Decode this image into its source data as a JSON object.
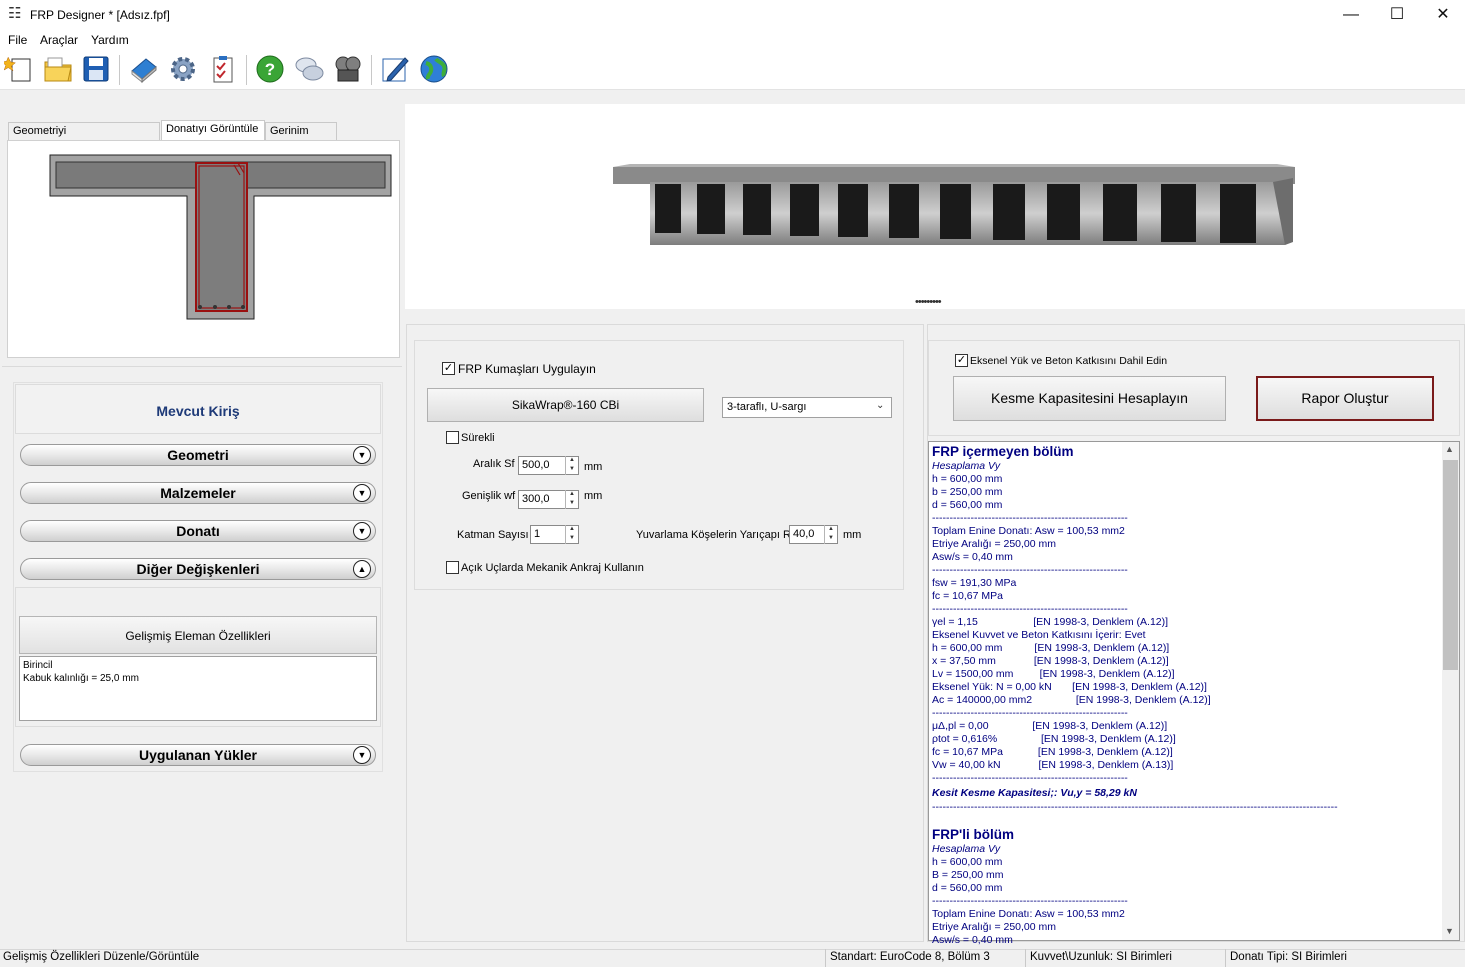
{
  "window": {
    "title": "FRP Designer * [Adsız.fpf]",
    "app_icon": "grid-icon",
    "controls": {
      "minimize": "—",
      "maximize": "☐",
      "close": "✕"
    }
  },
  "menu": [
    "File",
    "Araçlar",
    "Yardım"
  ],
  "toolbar": {
    "buttons": [
      "new-project-icon",
      "open-folder-icon",
      "save-icon",
      "book-icon",
      "settings-gear-icon",
      "checklist-icon",
      "help-icon",
      "chat-icon",
      "film-reel-icon",
      "pen-edit-icon",
      "globe-icon"
    ]
  },
  "left_tabs": [
    {
      "label": "Geometriyi Düzenle/Görüntüle",
      "active": false
    },
    {
      "label": "Donatıyı Görüntüle",
      "active": true
    },
    {
      "label": "Gerinim Profili",
      "active": false
    }
  ],
  "section": {
    "title": "Mevcut Kiriş",
    "items": [
      {
        "label": "Geometri",
        "state": "collapsed"
      },
      {
        "label": "Malzemeler",
        "state": "collapsed"
      },
      {
        "label": "Donatı",
        "state": "collapsed"
      },
      {
        "label": "Diğer Değişkenleri",
        "state": "expanded"
      }
    ],
    "advanced_button": "Gelişmiş Eleman Özellikleri",
    "advanced_text": [
      "Birincil",
      "Kabuk kalınlığı = 25,0 mm"
    ],
    "loads": {
      "label": "Uygulanan Yükler",
      "state": "collapsed"
    }
  },
  "frp": {
    "apply_label": "FRP Kumaşları Uygulayın",
    "apply_checked": true,
    "product_button": "SikaWrap®-160 CBi",
    "wrap_type": "3-taraflı, U-sargı",
    "continuous_label": "Sürekli",
    "continuous_checked": false,
    "spacing_label": "Aralık Sf",
    "spacing_value": "500,0",
    "width_label": "Genişlik wf",
    "width_value": "300,0",
    "unit_mm": "mm",
    "layers_label": "Katman Sayısı",
    "layers_value": "1",
    "radius_label": "Yuvarlama Köşelerin Yarıçapı R",
    "radius_value": "40,0",
    "anchor_label": "Açık Uçlarda Mekanik Ankraj Kullanın",
    "anchor_checked": false
  },
  "analysis": {
    "axial_label": "Eksenel Yük ve Beton Katkısını Dahil Edin",
    "axial_checked": true,
    "calc_button": "Kesme Kapasitesini Hesaplayın",
    "report_button": "Rapor Oluştur"
  },
  "results": [
    {
      "t": "FRP içermeyen bölüm",
      "s": "h"
    },
    {
      "t": "Hesaplama Vy",
      "s": "i"
    },
    {
      "t": "h = 600,00 mm"
    },
    {
      "t": "b = 250,00 mm"
    },
    {
      "t": "d = 560,00 mm"
    },
    {
      "t": "--------------------------------------------------------"
    },
    {
      "t": "Toplam Enine Donatı: Asw = 100,53 mm2"
    },
    {
      "t": "Etriye Aralığı = 250,00 mm"
    },
    {
      "t": "Asw/s = 0,40 mm"
    },
    {
      "t": "--------------------------------------------------------"
    },
    {
      "t": "fsw = 191,30 MPa"
    },
    {
      "t": "fc = 10,67 MPa"
    },
    {
      "t": "--------------------------------------------------------"
    },
    {
      "t": "γel = 1,15                   [EN 1998-3, Denklem (A.12)]"
    },
    {
      "t": "Eksenel Kuvvet ve Beton Katkısını İçerir: Evet"
    },
    {
      "t": "h = 600,00 mm           [EN 1998-3, Denklem (A.12)]"
    },
    {
      "t": "x = 37,50 mm             [EN 1998-3, Denklem (A.12)]"
    },
    {
      "t": "Lv = 1500,00 mm         [EN 1998-3, Denklem (A.12)]"
    },
    {
      "t": "Eksenel Yük: N = 0,00 kN       [EN 1998-3, Denklem (A.12)]"
    },
    {
      "t": "Ac = 140000,00 mm2               [EN 1998-3, Denklem (A.12)]"
    },
    {
      "t": "--------------------------------------------------------"
    },
    {
      "t": "μΔ,pl = 0,00               [EN 1998-3, Denklem (A.12)]"
    },
    {
      "t": "ρtot = 0,616%               [EN 1998-3, Denklem (A.12)]"
    },
    {
      "t": "fc = 10,67 MPa            [EN 1998-3, Denklem (A.12)]"
    },
    {
      "t": "Vw = 40,00 kN             [EN 1998-3, Denklem (A.13)]"
    },
    {
      "t": "--------------------------------------------------------"
    },
    {
      "t": "Kesit Kesme Kapasitesi;: Vu,y = 58,29 kN",
      "s": "bi"
    },
    {
      "t": "--------------------------------------------------------------------------------------------------------------------"
    },
    {
      "t": "",
      "s": "sp"
    },
    {
      "t": "FRP'li bölüm",
      "s": "h"
    },
    {
      "t": "Hesaplama Vy",
      "s": "i"
    },
    {
      "t": "h = 600,00 mm"
    },
    {
      "t": "B = 250,00 mm"
    },
    {
      "t": "d = 560,00 mm"
    },
    {
      "t": "--------------------------------------------------------"
    },
    {
      "t": "Toplam Enine Donatı: Asw = 100,53 mm2"
    },
    {
      "t": "Etriye Aralığı = 250,00 mm"
    },
    {
      "t": "Asw/s = 0,40 mm"
    }
  ],
  "status": {
    "left": "Gelişmiş Özellikleri Düzenle/Görüntüle",
    "standard": "Standart: EuroCode 8, Bölüm 3",
    "units": "Kuvvet\\Uzunluk: SI Birimleri",
    "rebar_type": "Donatı Tipi: SI Birimleri"
  }
}
